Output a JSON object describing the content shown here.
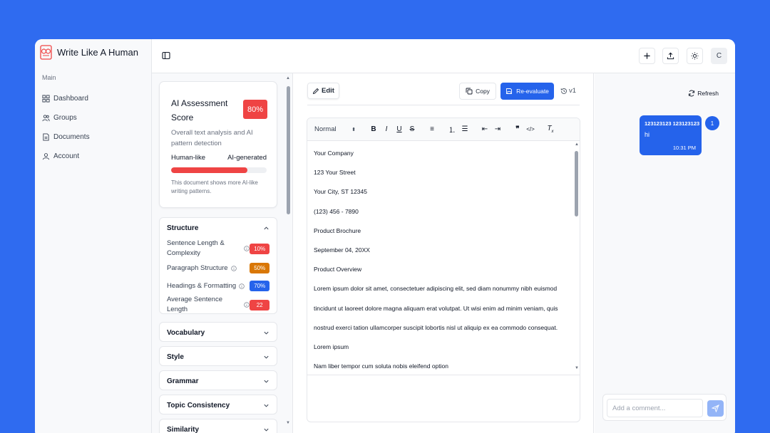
{
  "app": {
    "name": "Write Like A Human"
  },
  "sidebar": {
    "section": "Main",
    "items": [
      {
        "label": "Dashboard",
        "icon": "grid-icon"
      },
      {
        "label": "Groups",
        "icon": "users-icon"
      },
      {
        "label": "Documents",
        "icon": "file-icon"
      },
      {
        "label": "Account",
        "icon": "user-icon"
      }
    ]
  },
  "topbar": {
    "avatar_initial": "C"
  },
  "assessment": {
    "title": "AI Assessment Score",
    "score": "80%",
    "score_percent": 80,
    "score_color": "#ef4444",
    "description": "Overall text analysis and AI pattern detection",
    "scale_left": "Human-like",
    "scale_right": "AI-generated",
    "note": "This document shows more AI-like writing patterns."
  },
  "structure": {
    "title": "Structure",
    "metrics": [
      {
        "label": "Sentence Length & Complexity",
        "value": "10%",
        "color": "#ef4444"
      },
      {
        "label": "Paragraph Structure",
        "value": "50%",
        "color": "#d97706"
      },
      {
        "label": "Headings & Formatting",
        "value": "70%",
        "color": "#2563eb"
      },
      {
        "label": "Average Sentence Length",
        "value": "22",
        "color": "#ef4444"
      }
    ]
  },
  "sections": [
    "Vocabulary",
    "Style",
    "Grammar",
    "Topic Consistency",
    "Similarity"
  ],
  "editor": {
    "edit_label": "Edit",
    "copy_label": "Copy",
    "reevaluate_label": "Re-evaluate",
    "version": "v1",
    "toolbar_format": "Normal",
    "lines": [
      "Your Company",
      "123 Your Street",
      "Your City, ST 12345",
      "(123) 456 - 7890",
      "Product Brochure",
      "September 04, 20XX",
      "Product Overview",
      "Lorem ipsum dolor sit amet, consectetuer adipiscing elit, sed diam nonummy nibh euismod",
      "tincidunt ut laoreet dolore magna aliquam erat volutpat. Ut wisi enim ad minim veniam, quis",
      "nostrud exerci tation ullamcorper suscipit lobortis nisl ut aliquip ex ea commodo consequat.",
      "Lorem ipsum",
      "Nam liber tempor cum soluta nobis eleifend option"
    ]
  },
  "chat": {
    "refresh_label": "Refresh",
    "message_title": "123123123 123123123",
    "message_text": "hi",
    "message_time": "10:31 PM",
    "avatar_label": "1",
    "comment_placeholder": "Add a comment..."
  }
}
